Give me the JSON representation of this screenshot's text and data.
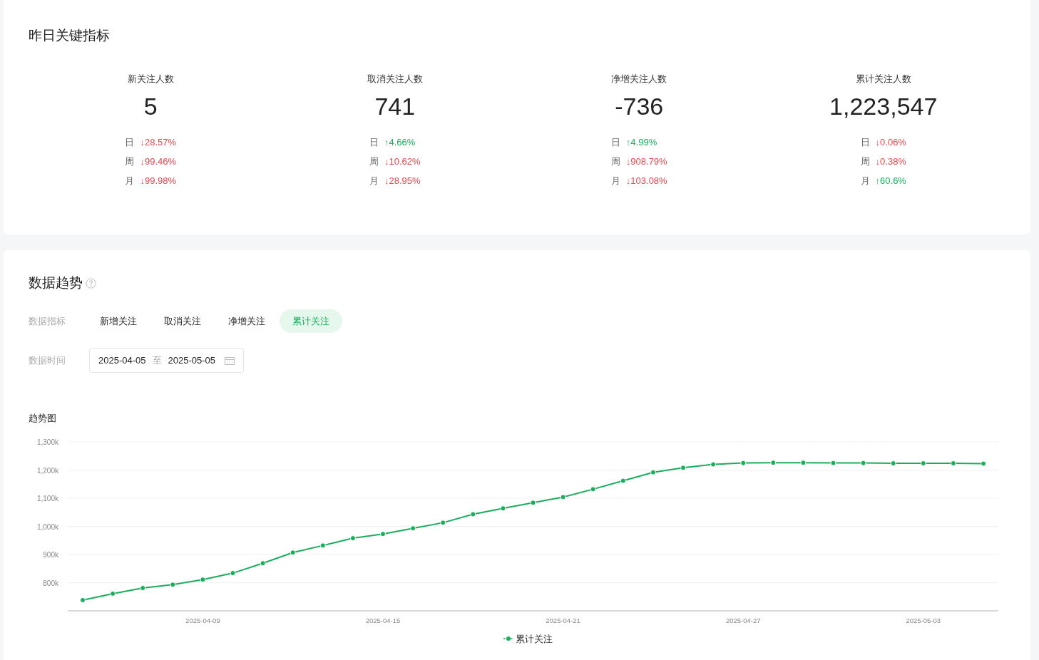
{
  "key_metrics": {
    "title": "昨日关键指标",
    "metrics": [
      {
        "label": "新关注人数",
        "value": "5",
        "changes": [
          {
            "period": "日",
            "arrow": "↓",
            "color": "#e5484d",
            "value": "28.57%"
          },
          {
            "period": "周",
            "arrow": "↓",
            "color": "#e5484d",
            "value": "99.46%"
          },
          {
            "period": "月",
            "arrow": "↓",
            "color": "#e5484d",
            "value": "99.98%"
          }
        ]
      },
      {
        "label": "取消关注人数",
        "value": "741",
        "changes": [
          {
            "period": "日",
            "arrow": "↑",
            "color": "#1aad5c",
            "value": "4.66%"
          },
          {
            "period": "周",
            "arrow": "↓",
            "color": "#e5484d",
            "value": "10.62%"
          },
          {
            "period": "月",
            "arrow": "↓",
            "color": "#e5484d",
            "value": "28.95%"
          }
        ]
      },
      {
        "label": "净增关注人数",
        "value": "-736",
        "changes": [
          {
            "period": "日",
            "arrow": "↑",
            "color": "#1aad5c",
            "value": "4.99%"
          },
          {
            "period": "周",
            "arrow": "↓",
            "color": "#e5484d",
            "value": "908.79%"
          },
          {
            "period": "月",
            "arrow": "↓",
            "color": "#e5484d",
            "value": "103.08%"
          }
        ]
      },
      {
        "label": "累计关注人数",
        "value": "1,223,547",
        "changes": [
          {
            "period": "日",
            "arrow": "↓",
            "color": "#e5484d",
            "value": "0.06%"
          },
          {
            "period": "周",
            "arrow": "↓",
            "color": "#e5484d",
            "value": "0.38%"
          },
          {
            "period": "月",
            "arrow": "↑",
            "color": "#1aad5c",
            "value": "60.6%"
          }
        ]
      }
    ]
  },
  "trend": {
    "title": "数据趋势",
    "metric_label": "数据指标",
    "metric_tabs": [
      {
        "label": "新增关注",
        "selected": false
      },
      {
        "label": "取消关注",
        "selected": false
      },
      {
        "label": "净增关注",
        "selected": false
      },
      {
        "label": "累计关注",
        "selected": true
      }
    ],
    "time_label": "数据时间",
    "date_range": {
      "start": "2025-04-05",
      "separator": "至",
      "end": "2025-05-05"
    },
    "chart_title": "趋势图",
    "chart_data": {
      "type": "line",
      "grid": true,
      "categories": [
        null,
        null,
        null,
        null,
        "2025-04-09",
        null,
        null,
        null,
        null,
        null,
        "2025-04-15",
        null,
        null,
        null,
        null,
        null,
        "2025-04-21",
        null,
        null,
        null,
        null,
        null,
        "2025-04-27",
        null,
        null,
        null,
        null,
        null,
        "2025-05-03",
        null,
        null
      ],
      "series": [
        {
          "name": "累计关注",
          "color": "#1aad5c",
          "marker": "circle",
          "values": [
            738,
            761,
            781,
            793,
            811,
            834,
            869,
            907,
            932,
            958,
            973,
            993,
            1013,
            1043,
            1064,
            1084,
            1104,
            1132,
            1162,
            1192,
            1208,
            1220,
            1225,
            1226,
            1226,
            1225,
            1225,
            1224,
            1224,
            1224,
            1223
          ]
        }
      ],
      "ylim": [
        700,
        1300
      ],
      "yticks": [
        {
          "value": 800,
          "label": "800k"
        },
        {
          "value": 900,
          "label": "900k"
        },
        {
          "value": 1000,
          "label": "1,000k"
        },
        {
          "value": 1100,
          "label": "1,100k"
        },
        {
          "value": 1200,
          "label": "1,200k"
        },
        {
          "value": 1300,
          "label": "1,300k"
        }
      ]
    }
  }
}
